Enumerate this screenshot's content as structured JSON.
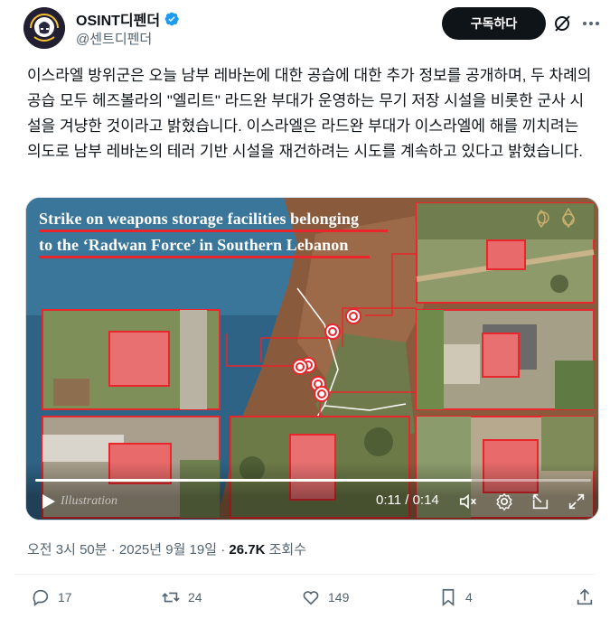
{
  "author": {
    "name": "OSINT디펜더",
    "handle": "@센트디펜더",
    "verified": true
  },
  "subscribe_label": "구독하다",
  "icons": {
    "grok": "grok-slash-icon",
    "more": "more-dots-icon",
    "verified": "verified-badge-icon"
  },
  "tweet_text": "이스라엘 방위군은 오늘 남부 레바논에 대한 공습에 대한 추가 정보를 공개하며, 두 차례의 공습 모두 헤즈볼라의 \"엘리트\" 라드완 부대가 운영하는 무기 저장 시설을 비롯한 군사 시설을 겨냥한 것이라고 밝혔습니다. 이스라엘은 라드완 부대가 이스라엘에 해를 끼치려는 의도로 남부 레바논의 테러 기반 시설을 재건하려는 시도를 계속하고 있다고 밝혔습니다.",
  "media": {
    "caption_line1": "Strike on weapons storage facilities belonging",
    "caption_line2": "to the ‘Radwan Force’ in Southern Lebanon",
    "watermark": "Illustration",
    "time_display": "0:11 / 0:14",
    "progress": 0.786,
    "accent_color": "#e8262b"
  },
  "meta": {
    "time": "오전 3시 50분",
    "date": "2025년 9월 19일",
    "views_count": "26.7K",
    "views_label": "조회수"
  },
  "actions": {
    "replies": "17",
    "reposts": "24",
    "likes": "149",
    "bookmarks": "4"
  }
}
